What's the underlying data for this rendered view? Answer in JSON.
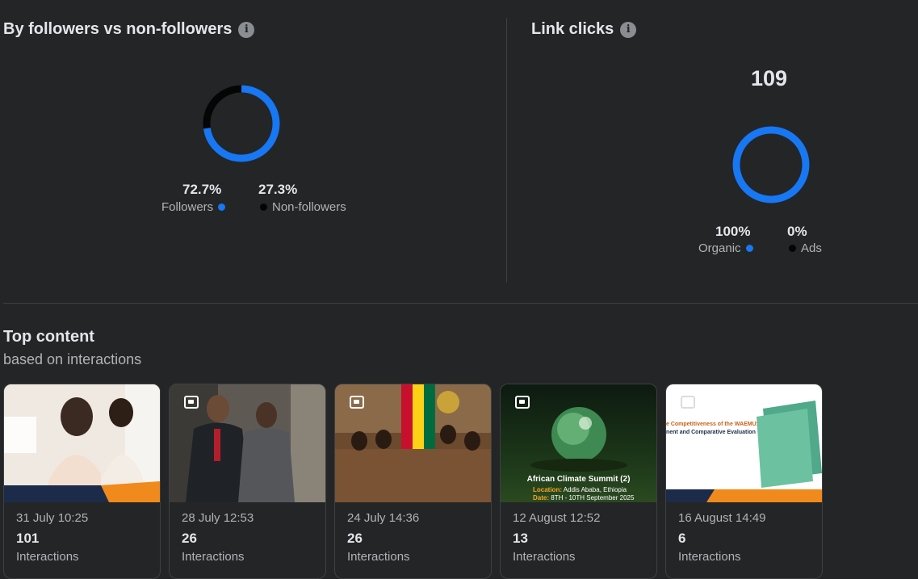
{
  "followers_section": {
    "title": "By followers vs non-followers",
    "info_icon": "info-icon",
    "followers_pct": "72.7%",
    "followers_label": "Followers",
    "non_followers_pct": "27.3%",
    "non_followers_label": "Non-followers",
    "followers_fraction": 0.727,
    "colors": {
      "followers": "#1877f2",
      "non_followers": "#050505"
    }
  },
  "link_clicks_section": {
    "title": "Link clicks",
    "info_icon": "info-icon",
    "total": "109",
    "organic_pct": "100%",
    "organic_label": "Organic",
    "ads_pct": "0%",
    "ads_label": "Ads",
    "organic_fraction": 1.0,
    "colors": {
      "organic": "#1877f2",
      "ads": "#050505"
    }
  },
  "top_content": {
    "title": "Top content",
    "subtitle": "based on interactions",
    "cards": [
      {
        "date": "31 July 10:25",
        "count": "101",
        "label": "Interactions"
      },
      {
        "date": "28 July 12:53",
        "count": "26",
        "label": "Interactions"
      },
      {
        "date": "24 July 14:36",
        "count": "26",
        "label": "Interactions"
      },
      {
        "date": "12 August 12:52",
        "count": "13",
        "label": "Interactions",
        "thumb_title": "African Climate Summit (2)",
        "thumb_location_label": "Location:",
        "thumb_location": "Addis Ababa, Ethiopia",
        "thumb_date_label": "Date:",
        "thumb_date": "8TH - 10TH September 2025"
      },
      {
        "date": "16 August 14:49",
        "count": "6",
        "label": "Interactions",
        "thumb_heading": "e Competitiveness of the WAEMU:",
        "thumb_subheading": "nent and Comparative Evaluation"
      }
    ]
  },
  "accent_color": "#1877f2"
}
